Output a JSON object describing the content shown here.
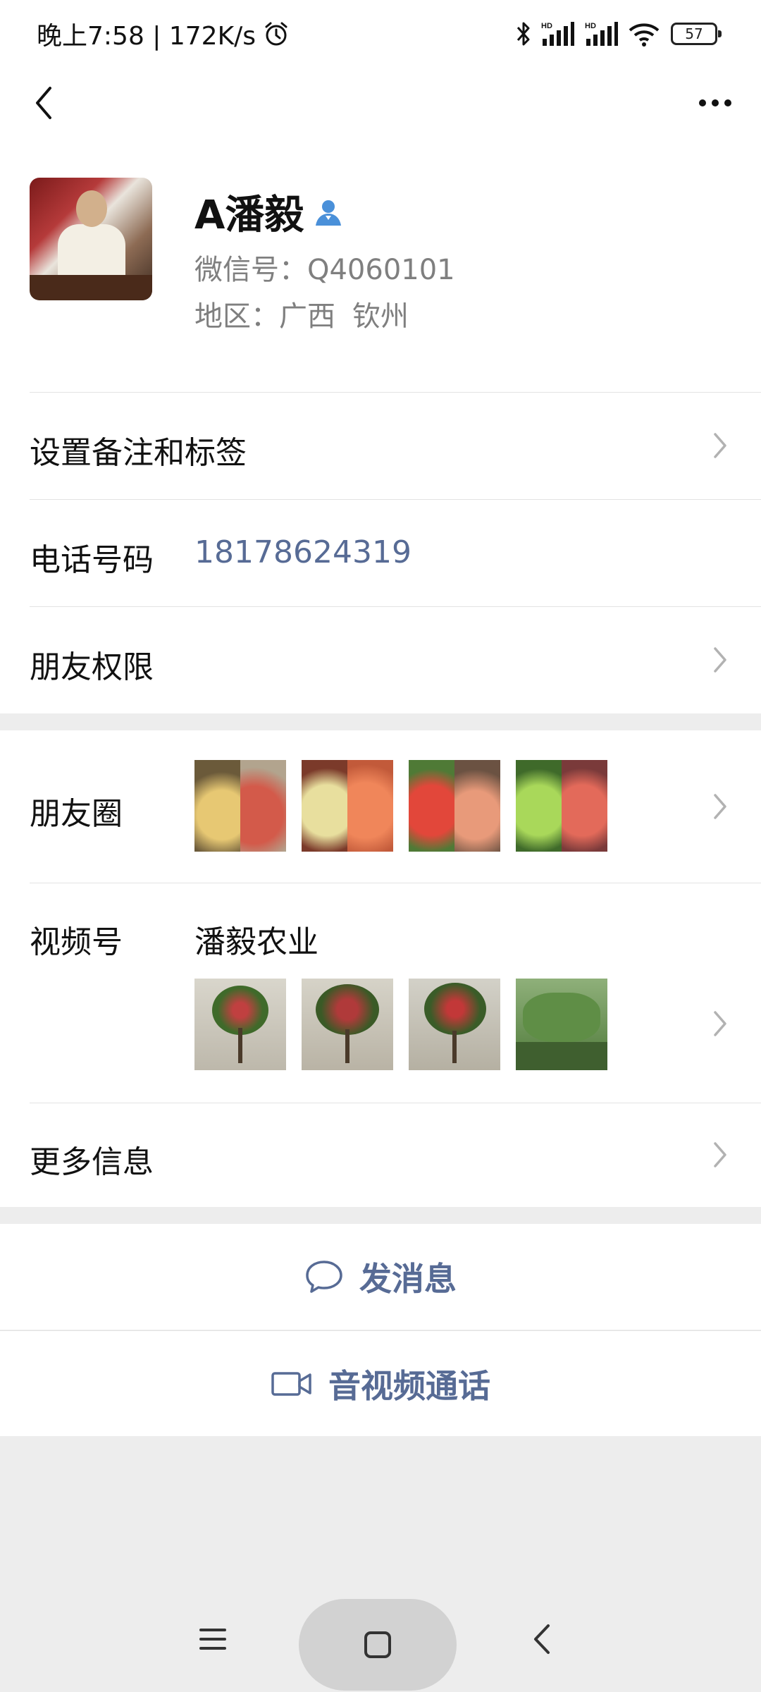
{
  "status_bar": {
    "time_speed": "晚上7:58 | 172K/s",
    "battery": "57"
  },
  "profile": {
    "name": "A潘毅",
    "wechat_id": "微信号：Q4060101",
    "region_label": "地区：广西",
    "region_city": "钦州"
  },
  "rows": {
    "remark_tags": "设置备注和标签",
    "phone_label": "电话号码",
    "phone_value": "18178624319",
    "friend_permission": "朋友权限",
    "moments": "朋友圈",
    "channels": "视频号",
    "channel_name": "潘毅农业",
    "more_info": "更多信息"
  },
  "actions": {
    "send_message": "发消息",
    "av_call": "音视频通话"
  },
  "colors": {
    "link": "#576b95",
    "background": "#ededed",
    "verified": "#4a90d9"
  }
}
